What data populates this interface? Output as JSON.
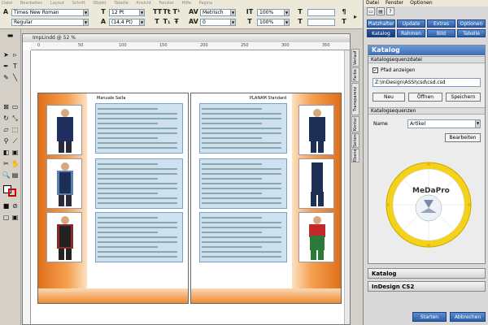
{
  "menubar": [
    "Datei",
    "Bearbeiten",
    "Layout",
    "Schrift",
    "Objekt",
    "Tabelle",
    "Ansicht",
    "Fenster",
    "Hilfe",
    "Pagina"
  ],
  "control": {
    "font_family": "Times New Roman",
    "font_style": "Regular",
    "font_size": "12 Pt",
    "leading": "(14,4 Pt)",
    "kerning": "Metrisch",
    "scale_h": "100%",
    "scale_v": "100%",
    "tracking": "0"
  },
  "document": {
    "title": "ImpLindd @ 52 %",
    "ruler_ticks": [
      "0",
      "50",
      "100",
      "150",
      "200",
      "250",
      "300",
      "350"
    ],
    "left_page_label": "Manuale Saita",
    "right_page_label": "PLANAM Standard"
  },
  "side_tabs": [
    "Verlauf",
    "Farbe",
    "Transparenz",
    "Kontur",
    "Seiten",
    "Ebenen"
  ],
  "panel": {
    "menu": [
      "Datei",
      "Fenster",
      "Optionen"
    ],
    "tabs_row1": [
      "Platzhalter",
      "Update",
      "Extras",
      "Optionen"
    ],
    "tabs_row2": [
      "Katalog",
      "Rahmen",
      "Bild",
      "Tabelle"
    ],
    "title": "Katalog",
    "section_file": "Katalogsequenzdatei",
    "checkbox_label": "Pfad anzeigen",
    "path_value": "Z:\\InDesign\\ASSI\\csd\\csd.csd",
    "btn_new": "Neu",
    "btn_open": "Öffnen",
    "btn_save": "Speichern",
    "section_seq": "Katalogsequenzen",
    "name_label": "Name",
    "name_value": "Artikel",
    "btn_edit": "Bearbeiten",
    "acc1": "Katalog",
    "acc2": "InDesign CS2",
    "btn_start": "Starten",
    "btn_cancel": "Abbrechen",
    "wheel_center": "MeDaPro"
  },
  "colors": {
    "accent_blue": "#3e6cb4",
    "orange": "#e0701a",
    "wheel_yellow": "#f4d21a"
  }
}
